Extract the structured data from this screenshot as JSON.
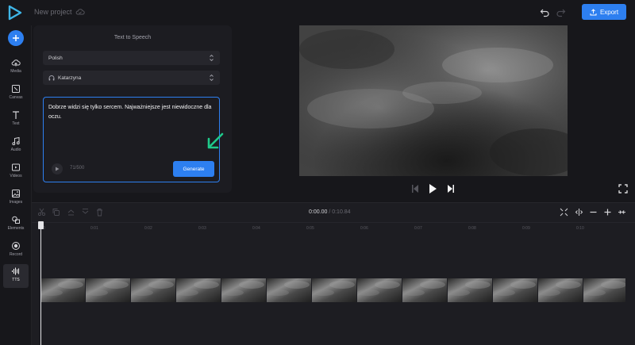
{
  "header": {
    "project_name": "New project",
    "export_label": "Export"
  },
  "sidebar": {
    "items": [
      {
        "label": "Media"
      },
      {
        "label": "Canvas"
      },
      {
        "label": "Text"
      },
      {
        "label": "Audio"
      },
      {
        "label": "Videos"
      },
      {
        "label": "Images"
      },
      {
        "label": "Elements"
      },
      {
        "label": "Record"
      },
      {
        "label": "TTS"
      }
    ]
  },
  "tts": {
    "title": "Text to Speech",
    "language": "Polish",
    "voice": "Katarzyna",
    "text": "Dobrze widzi się tylko sercem. Najważniejsze jest niewidoczne dla oczu.",
    "char_count": "71/500",
    "generate_label": "Generate"
  },
  "timeline": {
    "current_time": "0:00.00",
    "separator": "/",
    "total_time": "0:10.84",
    "ticks": [
      "0",
      "0:01",
      "0:02",
      "0:03",
      "0:04",
      "0:05",
      "0:06",
      "0:07",
      "0:08",
      "0:09",
      "0:10"
    ]
  },
  "colors": {
    "accent": "#2d7ff0",
    "arrow": "#1fc98a"
  }
}
